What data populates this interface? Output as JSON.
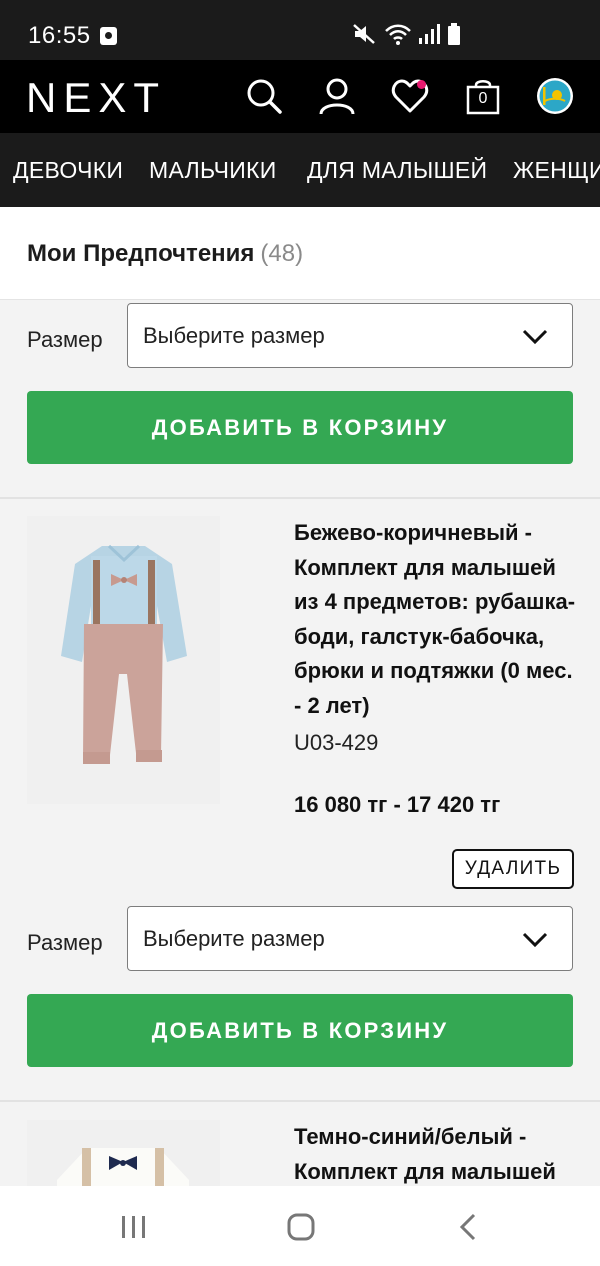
{
  "status_bar": {
    "time": "16:55"
  },
  "header": {
    "logo": "NEXT",
    "bag_count": "0"
  },
  "categories": [
    "ДЕВОЧКИ",
    "МАЛЬЧИКИ",
    "ДЛЯ МАЛЫШЕЙ",
    "ЖЕНЩИНЫ"
  ],
  "page": {
    "title": "Мои Предпочтения",
    "count": "(48)"
  },
  "size_label": "Размер",
  "size_placeholder": "Выберите размер",
  "add_to_cart": "ДОБАВИТЬ В КОРЗИНУ",
  "remove": "УДАЛИТЬ",
  "products": [
    {
      "title": "Бежево-коричневый - Комплект для малышей из 4 предметов: рубашка-боди, галстук-бабочка, брюки и подтяжки (0 мес. - 2 лет)",
      "code": "U03-429",
      "price": "16 080 тг - 17 420 тг"
    },
    {
      "title": "Темно-синий/белый - Комплект для малышей"
    }
  ],
  "colors": {
    "header_bg": "#000000",
    "add_button": "#34a853",
    "wishlist_dot": "#e7196f"
  }
}
